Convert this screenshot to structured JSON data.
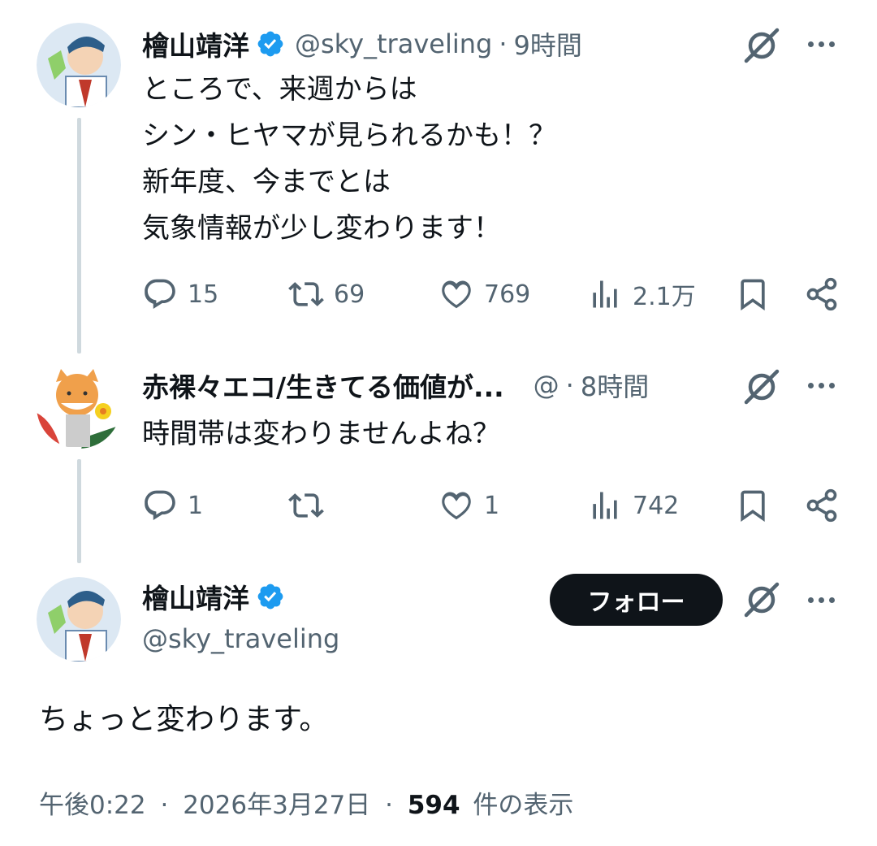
{
  "tweets": [
    {
      "author": "檜山靖洋",
      "handle": "@sky_traveling",
      "separator": "·",
      "time": "9時間",
      "text": "ところで、来週からは\nシン・ヒヤマが見られるかも！？\n新年度、今までとは\n気象情報が少し変わります！",
      "replies": "15",
      "reposts": "69",
      "likes": "769",
      "views": "2.1万"
    },
    {
      "author": "赤裸々エコ/生きてる価値が...",
      "handle": "@",
      "separator": "·",
      "time": "8時間",
      "text": "時間帯は変わりませんよね？",
      "replies": "1",
      "reposts": "",
      "likes": "1",
      "views": "742"
    }
  ],
  "main_tweet": {
    "author": "檜山靖洋",
    "handle": "@sky_traveling",
    "follow_label": "フォロー",
    "text": "ちょっと変わります。",
    "timestamp": "午後0:22",
    "separator": "·",
    "date": "2026年3月27日",
    "view_count": "594",
    "view_suffix": "件の表示"
  },
  "colors": {
    "text": "#0f1419",
    "secondary": "#536471",
    "verified": "#1d9bf0",
    "thread_line": "#cfd9de"
  },
  "icons": [
    "verified-badge-icon",
    "grok-icon",
    "more-icon",
    "reply-icon",
    "repost-icon",
    "like-icon",
    "views-icon",
    "bookmark-icon",
    "share-icon"
  ]
}
